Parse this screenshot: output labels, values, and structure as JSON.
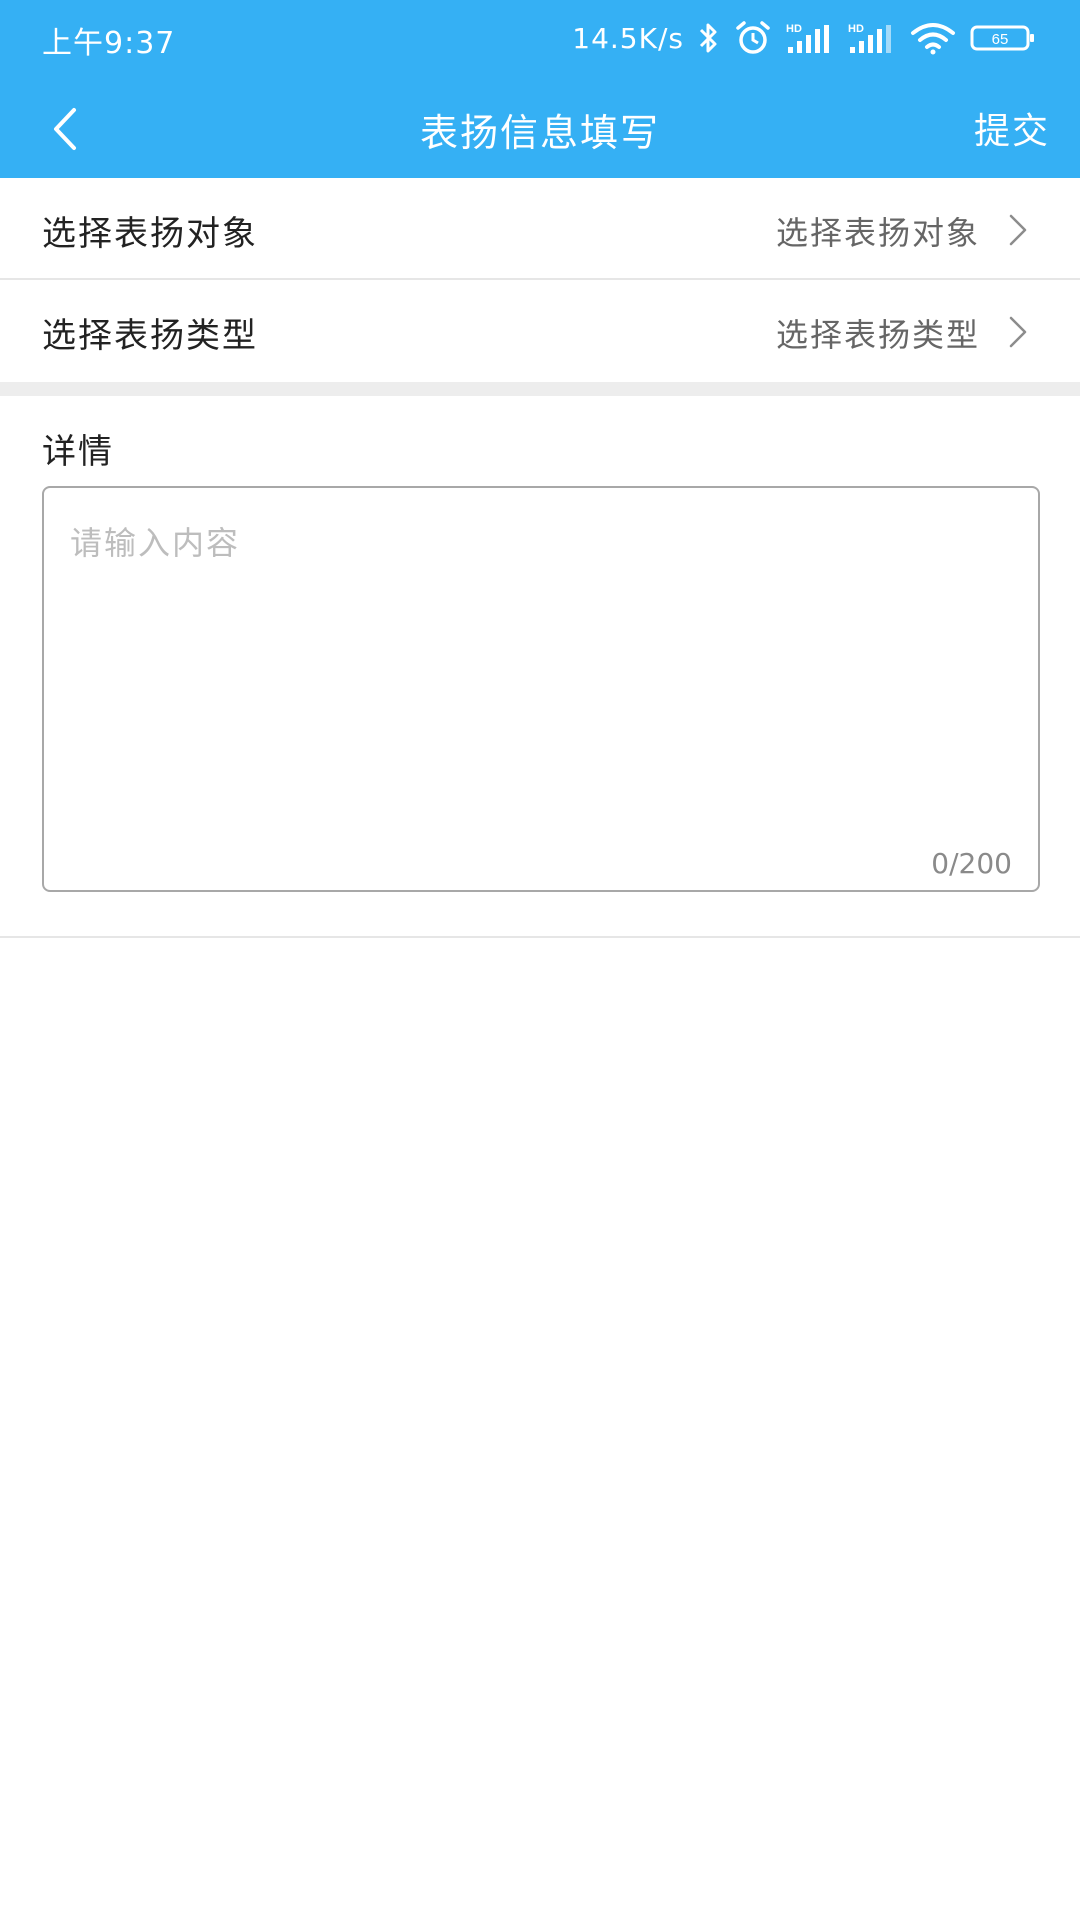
{
  "status_bar": {
    "time": "上午9:37",
    "network_speed": "14.5K/s",
    "icons": [
      "bluetooth-icon",
      "alarm-icon",
      "signal-hd-icon",
      "signal-hd-icon",
      "wifi-icon",
      "battery-icon"
    ],
    "battery_level": "65"
  },
  "nav": {
    "title": "表扬信息填写",
    "back_icon": "chevron-left-icon",
    "submit_label": "提交"
  },
  "form": {
    "rows": [
      {
        "label": "选择表扬对象",
        "value": "选择表扬对象",
        "icon": "chevron-right-icon"
      },
      {
        "label": "选择表扬类型",
        "value": "选择表扬类型",
        "icon": "chevron-right-icon"
      }
    ],
    "details": {
      "label": "详情",
      "placeholder": "请输入内容",
      "counter": "0/200"
    }
  },
  "colors": {
    "header": "#35b0f4",
    "text_primary": "#222222",
    "text_secondary": "#666666",
    "placeholder": "#bdbdbd",
    "divider": "#e6e6e6"
  }
}
